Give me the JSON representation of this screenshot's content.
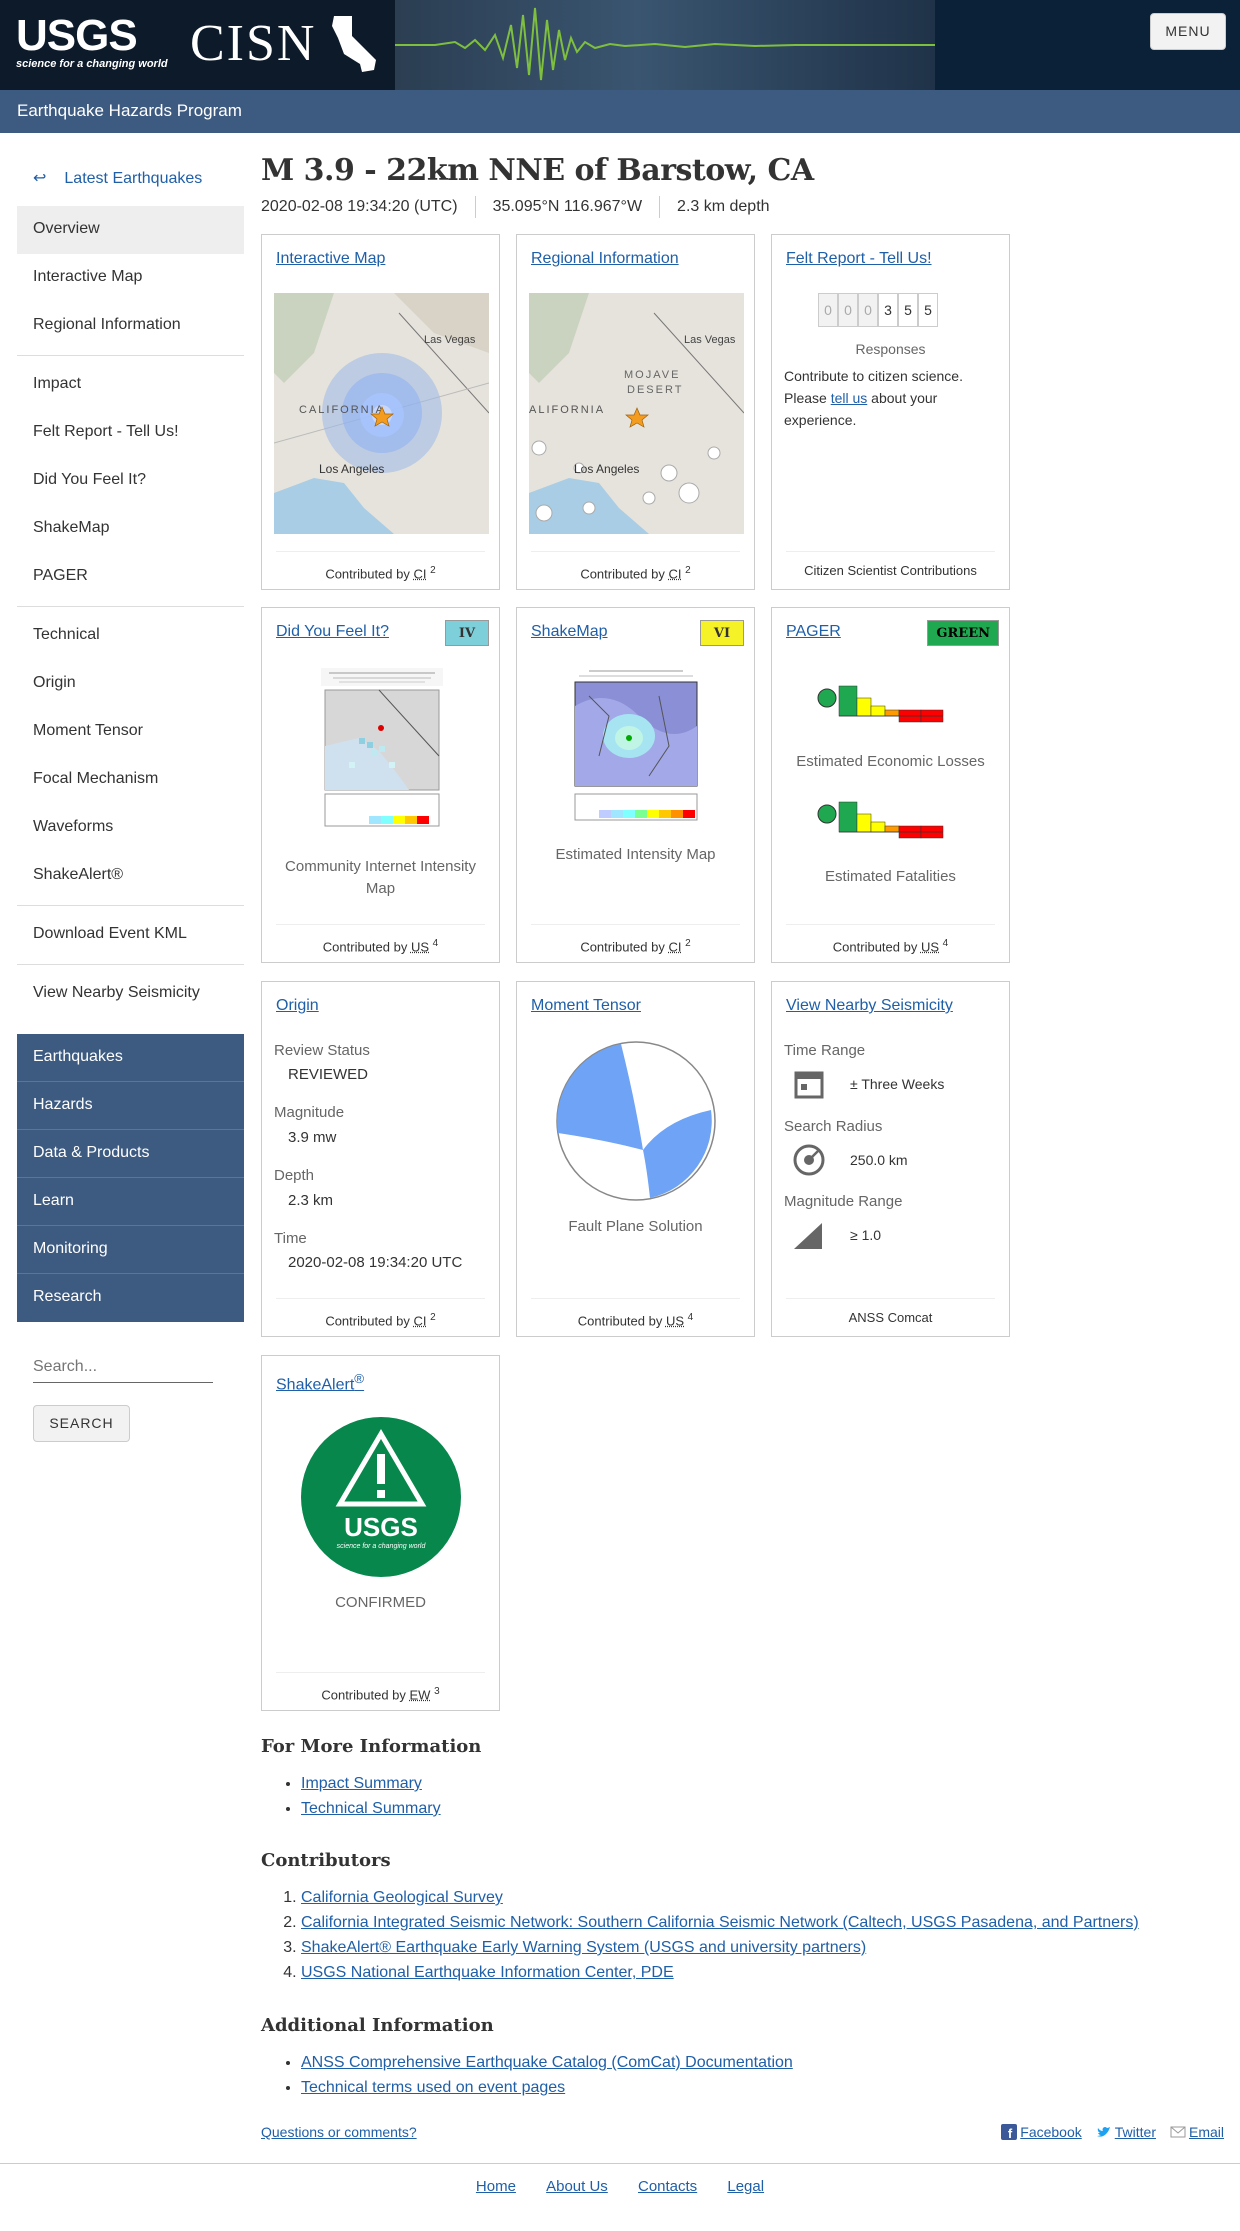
{
  "header": {
    "usgs_word": "USGS",
    "usgs_tagline": "science for a changing world",
    "cisn_word": "CISN",
    "menu_label": "MENU",
    "program_title": "Earthquake Hazards Program"
  },
  "sidebar": {
    "back_label": "Latest Earthquakes",
    "items": [
      "Overview",
      "Interactive Map",
      "Regional Information",
      "Impact",
      "Felt Report - Tell Us!",
      "Did You Feel It?",
      "ShakeMap",
      "PAGER",
      "Technical",
      "Origin",
      "Moment Tensor",
      "Focal Mechanism",
      "Waveforms",
      "ShakeAlert®",
      "Download Event KML",
      "View Nearby Seismicity"
    ],
    "nav": [
      "Earthquakes",
      "Hazards",
      "Data & Products",
      "Learn",
      "Monitoring",
      "Research"
    ],
    "search_placeholder": "Search...",
    "search_button": "SEARCH"
  },
  "event": {
    "title": "M 3.9 - 22km NNE of Barstow, CA",
    "time": "2020-02-08 19:34:20 (UTC)",
    "location": "35.095°N 116.967°W",
    "depth": "2.3 km depth"
  },
  "cards": {
    "interactive_map": {
      "title": "Interactive Map",
      "contrib": "CI",
      "contrib_n": "2",
      "labels": {
        "las_vegas": "Las Vegas",
        "california": "CALIFORNIA",
        "los_angeles": "Los Angeles"
      }
    },
    "regional": {
      "title": "Regional Information",
      "contrib": "CI",
      "contrib_n": "2",
      "labels": {
        "las_vegas": "Las Vegas",
        "mojave": "MOJAVE",
        "desert": "DESERT",
        "california": "ALIFORNIA",
        "los_angeles": "Los Angeles"
      }
    },
    "felt": {
      "title": "Felt Report - Tell Us!",
      "digits": [
        "0",
        "0",
        "0",
        "3",
        "5",
        "5"
      ],
      "responses": "Responses",
      "text_before": "Contribute to citizen science. Please ",
      "link": "tell us",
      "text_after": " about your experience.",
      "footer": "Citizen Scientist Contributions"
    },
    "dyfi": {
      "title": "Did You Feel It?",
      "badge": "IV",
      "badge_color": "#7dcfd9",
      "caption": "Community Internet Intensity Map",
      "contrib": "US",
      "contrib_n": "4"
    },
    "shakemap": {
      "title": "ShakeMap",
      "badge": "VI",
      "badge_color": "#f5f227",
      "caption": "Estimated Intensity Map",
      "contrib": "CI",
      "contrib_n": "2"
    },
    "pager": {
      "title": "PAGER",
      "badge": "GREEN",
      "badge_color": "#1fa84f",
      "caption1": "Estimated Economic Losses",
      "caption2": "Estimated Fatalities",
      "contrib": "US",
      "contrib_n": "4"
    },
    "origin": {
      "title": "Origin",
      "review_label": "Review Status",
      "review_value": "REVIEWED",
      "mag_label": "Magnitude",
      "mag_value": "3.9 mw",
      "depth_label": "Depth",
      "depth_value": "2.3 km",
      "time_label": "Time",
      "time_value": "2020-02-08 19:34:20 UTC",
      "contrib": "CI",
      "contrib_n": "2"
    },
    "moment": {
      "title": "Moment Tensor",
      "caption": "Fault Plane Solution",
      "contrib": "US",
      "contrib_n": "4"
    },
    "nearby": {
      "title": "View Nearby Seismicity",
      "time_label": "Time Range",
      "time_value": "± Three Weeks",
      "radius_label": "Search Radius",
      "radius_value": "250.0 km",
      "mag_label": "Magnitude Range",
      "mag_value": "≥ 1.0",
      "footer": "ANSS Comcat"
    },
    "shakealert": {
      "title": "ShakeAlert",
      "title_sup": "®",
      "logo_word": "USGS",
      "logo_tag": "science for a changing world",
      "status": "CONFIRMED",
      "contrib": "EW",
      "contrib_n": "3"
    }
  },
  "more_info": {
    "heading": "For More Information",
    "links": [
      "Impact Summary",
      "Technical Summary"
    ]
  },
  "contributors": {
    "heading": "Contributors",
    "items": [
      "California Geological Survey",
      "California Integrated Seismic Network: Southern California Seismic Network (Caltech, USGS Pasadena, and Partners)",
      "ShakeAlert® Earthquake Early Warning System (USGS and university partners)",
      "USGS National Earthquake Information Center, PDE"
    ]
  },
  "additional": {
    "heading": "Additional Information",
    "links": [
      "ANSS Comprehensive Earthquake Catalog (ComCat) Documentation",
      "Technical terms used on event pages"
    ]
  },
  "bottom": {
    "questions": "Questions or comments?",
    "facebook": "Facebook",
    "twitter": "Twitter",
    "email": "Email"
  },
  "footer_nav": [
    "Home",
    "About Us",
    "Contacts",
    "Legal"
  ]
}
